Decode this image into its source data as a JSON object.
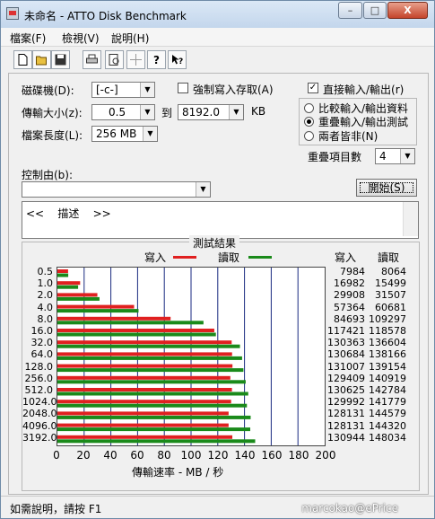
{
  "window": {
    "title": "未命名 - ATTO Disk Benchmark",
    "min_label": "–",
    "max_label": "□",
    "close_label": "X"
  },
  "menu": [
    "檔案(F)",
    "檢視(V)",
    "說明(H)"
  ],
  "toolbar": [
    "new-icon",
    "open-icon",
    "save-icon",
    "print-icon",
    "print-preview-icon",
    "move-icon",
    "help-icon",
    "context-help-icon"
  ],
  "form": {
    "drive_label": "磁碟機(D):",
    "drive_value": "[-c-]",
    "transfer_label": "傳輸大小(z):",
    "transfer_from": "0.5",
    "to_label": "到",
    "transfer_to": "8192.0",
    "unit": "KB",
    "length_label": "檔案長度(L):",
    "length_value": "256 MB",
    "force_write_label": "強制寫入存取(A)",
    "force_write_checked": false,
    "direct_io_label": "直接輸入/輸出(r)",
    "direct_io_checked": true,
    "radio_compare": "比較輸入/輸出資料",
    "radio_overlap": "重疊輸入/輸出測試",
    "radio_neither": "兩者皆非(N)",
    "queue_label": "重疊項目數",
    "queue_value": "4",
    "control_label": "控制由(b):",
    "start_button": "開始(S)",
    "description": "<<    描述    >>"
  },
  "results": {
    "title": "測試結果",
    "write_label": "寫入",
    "read_label": "讀取",
    "col_write": "寫入",
    "col_read": "讀取",
    "write_color": "#e02020",
    "read_color": "#1a8a1a"
  },
  "chart_data": {
    "type": "bar",
    "orientation": "horizontal",
    "categories": [
      "0.5",
      "1.0",
      "2.0",
      "4.0",
      "8.0",
      "16.0",
      "32.0",
      "64.0",
      "128.0",
      "256.0",
      "512.0",
      "1024.0",
      "2048.0",
      "4096.0",
      "3192.0"
    ],
    "series": [
      {
        "name": "寫入",
        "values": [
          8.0,
          17.0,
          29.9,
          57.4,
          84.7,
          117.4,
          130.4,
          130.7,
          131.0,
          129.4,
          130.6,
          130.0,
          128.1,
          128.1,
          130.9
        ]
      },
      {
        "name": "讀取",
        "values": [
          8.1,
          15.5,
          31.5,
          60.7,
          109.3,
          118.6,
          136.6,
          138.2,
          139.2,
          140.9,
          142.8,
          141.8,
          144.6,
          144.3,
          148.0
        ]
      }
    ],
    "write_values": [
      "7984",
      "16982",
      "29908",
      "57364",
      "84693",
      "117421",
      "130363",
      "130684",
      "131007",
      "129409",
      "130625",
      "129992",
      "128131",
      "128131",
      "130944"
    ],
    "read_values": [
      "8064",
      "15499",
      "31507",
      "60681",
      "109297",
      "118578",
      "136604",
      "138166",
      "139154",
      "140919",
      "142784",
      "141779",
      "144579",
      "144320",
      "148034"
    ],
    "xlim": [
      0,
      200
    ],
    "xticks": [
      "0",
      "20",
      "40",
      "60",
      "80",
      "100",
      "120",
      "140",
      "160",
      "180",
      "200"
    ],
    "xlabel": "傳輸速率 - MB / 秒"
  },
  "status": {
    "help_text": "如需說明，請按 F1",
    "watermark": "marcokao@ePrice"
  }
}
